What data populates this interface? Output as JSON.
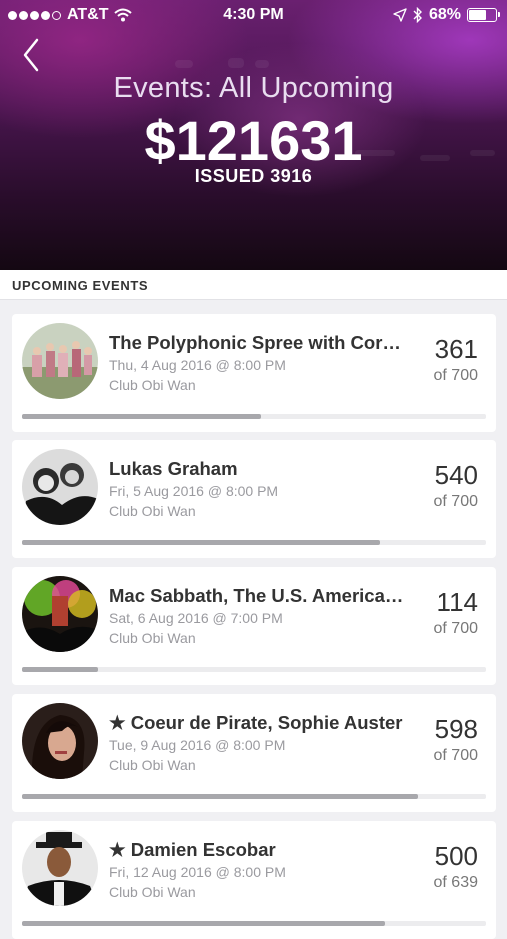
{
  "status_bar": {
    "carrier": "AT&T",
    "time": "4:30 PM",
    "battery": "68%",
    "battery_level": 0.68,
    "signal_dots": 4
  },
  "header": {
    "title": "Events: All Upcoming",
    "amount": "$121631",
    "issued": "ISSUED 3916"
  },
  "section": {
    "title": "UPCOMING EVENTS"
  },
  "events": [
    {
      "title": "The Polyphonic Spree with Cor…",
      "date": "Thu, 4 Aug 2016 @ 8:00 PM",
      "venue": "Club Obi Wan",
      "count": "361",
      "capacity": "of 700",
      "progress": 0.516
    },
    {
      "title": "Lukas Graham",
      "date": "Fri, 5 Aug 2016 @ 8:00 PM",
      "venue": "Club Obi Wan",
      "count": "540",
      "capacity": "of 700",
      "progress": 0.771
    },
    {
      "title": "Mac Sabbath, The U.S. America…",
      "date": "Sat, 6 Aug 2016 @ 7:00 PM",
      "venue": "Club Obi Wan",
      "count": "114",
      "capacity": "of 700",
      "progress": 0.163
    },
    {
      "title": "★ Coeur de Pirate, Sophie Auster",
      "date": "Tue, 9 Aug 2016 @ 8:00 PM",
      "venue": "Club Obi Wan",
      "count": "598",
      "capacity": "of 700",
      "progress": 0.854
    },
    {
      "title": "★ Damien Escobar",
      "date": "Fri, 12 Aug 2016 @ 8:00 PM",
      "venue": "Club Obi Wan",
      "count": "500",
      "capacity": "of 639",
      "progress": 0.782
    }
  ],
  "colors": {
    "accent": "#a8a8ac",
    "header_bg": "#4a1650"
  }
}
